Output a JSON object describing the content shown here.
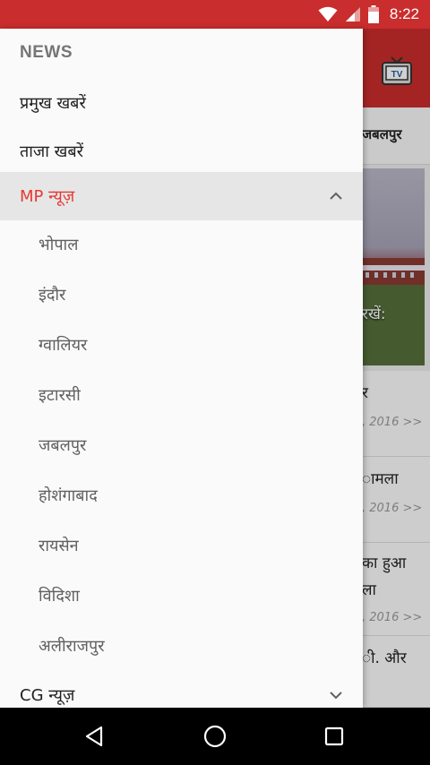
{
  "status_bar": {
    "time": "8:22"
  },
  "background": {
    "tab_label": "जबलपुर",
    "hero_caption": "रखें:",
    "cards": [
      {
        "title": "र",
        "date": ", 2016 >>"
      },
      {
        "title": "ामला",
        "date": ", 2016 >>"
      },
      {
        "title": "का हुआ",
        "title2": "ला",
        "date": ", 2016 >>"
      },
      {
        "title": "ी. और",
        "date": ""
      }
    ]
  },
  "drawer": {
    "header": "NEWS",
    "items": [
      {
        "label": "प्रमुख खबरें"
      },
      {
        "label": "ताजा खबरें"
      }
    ],
    "mp": {
      "label": "MP न्यूज़",
      "accent": "#e53935",
      "expanded": true,
      "children": [
        "भोपाल",
        "इंदौर",
        "ग्वालियर",
        "इटारसी",
        "जबलपुर",
        "होशंगाबाद",
        "रायसेन",
        "विदिशा",
        "अलीराजपुर"
      ]
    },
    "cg": {
      "label": "CG न्यूज़",
      "expanded": false
    }
  },
  "nav": {
    "back_icon": "back-triangle-icon",
    "home_icon": "home-circle-icon",
    "recents_icon": "recents-square-icon"
  },
  "colors": {
    "primary": "#c92d2d",
    "accent": "#e53935"
  }
}
